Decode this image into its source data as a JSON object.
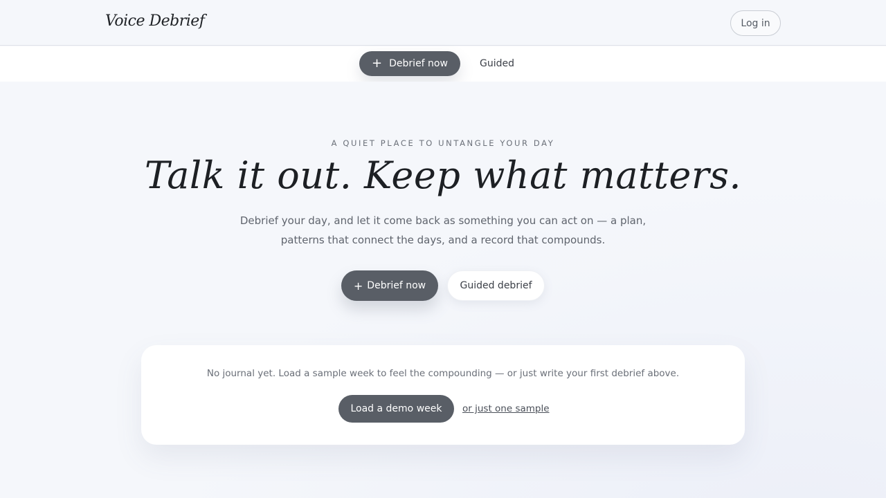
{
  "header": {
    "brand": "Voice Debrief",
    "login_label": "Log in"
  },
  "subnav": {
    "primary_icon": "+",
    "primary_label": "Debrief now",
    "secondary_label": "Guided"
  },
  "hero": {
    "eyebrow": "A QUIET PLACE TO UNTANGLE YOUR DAY",
    "headline": "Talk it out. Keep what matters.",
    "subtitle_line1": "Debrief your day, and let it come back as something you can act on — a plan,",
    "subtitle_line2": "patterns that connect the days, and a record that compounds.",
    "primary_icon": "+",
    "primary_label": "Debrief now",
    "secondary_label": "Guided debrief"
  },
  "empty_state": {
    "message": "No journal yet. Load a sample week to feel the compounding — or just write your first debrief above.",
    "demo_button_label": "Load a demo week",
    "sample_link_label": "or just one sample"
  },
  "colors": {
    "background": "#f5f7fb",
    "button_dark": "#595e66",
    "card": "#ffffff"
  }
}
